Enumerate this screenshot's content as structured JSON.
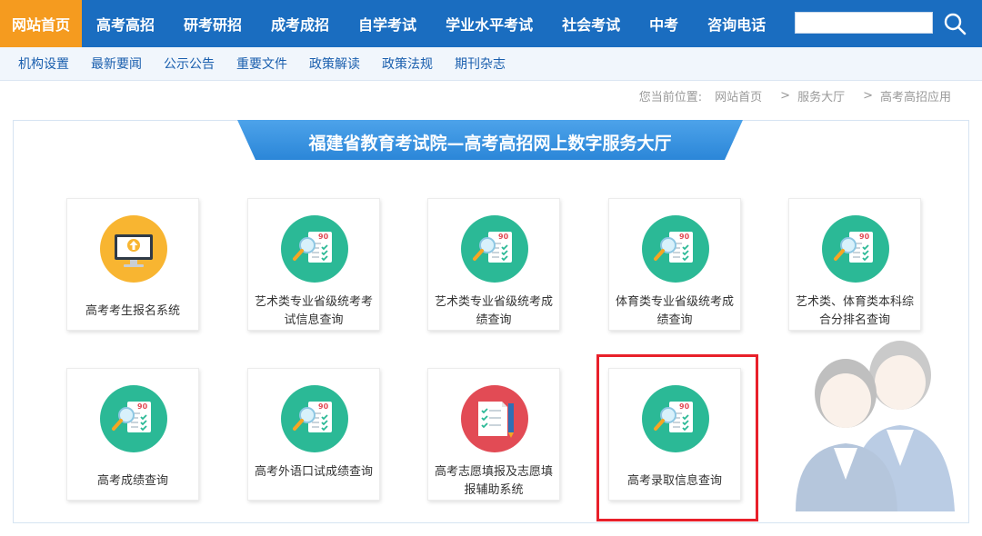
{
  "topnav": {
    "items": [
      {
        "label": "网站首页",
        "active": true
      },
      {
        "label": "高考高招"
      },
      {
        "label": "研考研招"
      },
      {
        "label": "成考成招"
      },
      {
        "label": "自学考试"
      },
      {
        "label": "学业水平考试"
      },
      {
        "label": "社会考试"
      },
      {
        "label": "中考"
      },
      {
        "label": "咨询电话"
      }
    ],
    "search_value": "",
    "search_icon": "search-icon"
  },
  "subnav": {
    "items": [
      "机构设置",
      "最新要闻",
      "公示公告",
      "重要文件",
      "政策解读",
      "政策法规",
      "期刊杂志"
    ]
  },
  "breadcrumb": {
    "prefix": "您当前位置:",
    "items": [
      "网站首页",
      "服务大厅",
      "高考高招应用"
    ],
    "separator": ">"
  },
  "panel": {
    "title": "福建省教育考试院—高考高招网上数字服务大厅"
  },
  "cards": [
    {
      "label": "高考考生报名系统",
      "icon": "monitor-upload-icon"
    },
    {
      "label": "艺术类专业省级统考考试信息查询",
      "icon": "score-search-icon"
    },
    {
      "label": "艺术类专业省级统考成绩查询",
      "icon": "score-search-icon"
    },
    {
      "label": "体育类专业省级统考成绩查询",
      "icon": "score-search-icon"
    },
    {
      "label": "艺术类、体育类本科综合分排名查询",
      "icon": "score-search-icon"
    },
    {
      "label": "高考成绩查询",
      "icon": "score-search-icon"
    },
    {
      "label": "高考外语口试成绩查询",
      "icon": "score-search-icon"
    },
    {
      "label": "高考志愿填报及志愿填报辅助系统",
      "icon": "form-pencil-icon"
    },
    {
      "label": "高考录取信息查询",
      "icon": "score-search-icon",
      "highlighted": true
    }
  ],
  "colors": {
    "nav_blue": "#1a6dc0",
    "nav_active": "#f59b1f",
    "teal": "#2bb996",
    "red_icon": "#e24b55",
    "highlight": "#e8202a"
  }
}
